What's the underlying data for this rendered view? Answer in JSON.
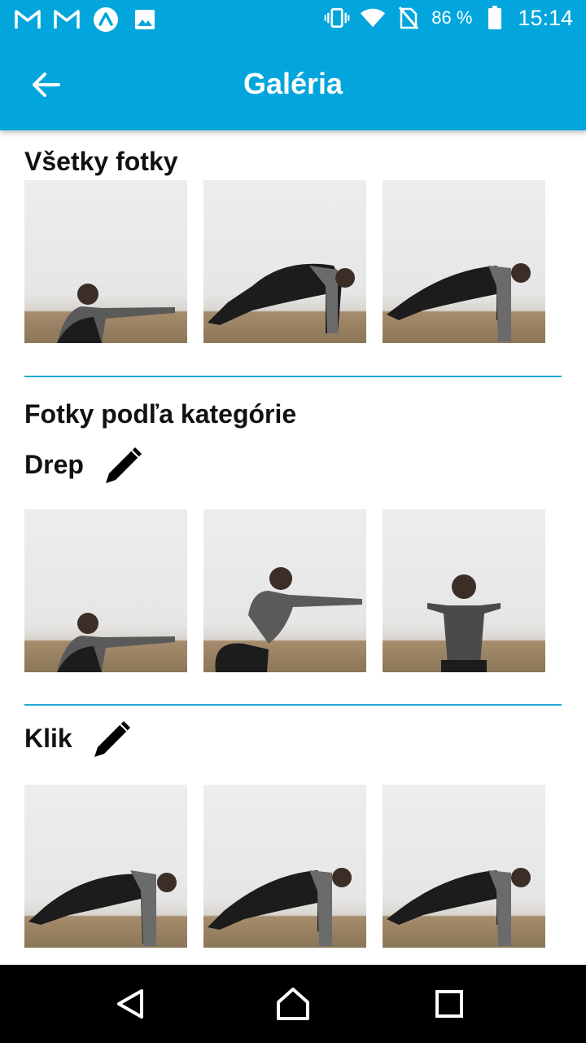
{
  "status_bar": {
    "icons_left": [
      "gmail-icon",
      "gmail-icon",
      "app-logo-icon",
      "image-icon"
    ],
    "battery_percent": "86 %",
    "time": "15:14"
  },
  "app_bar": {
    "title": "Galéria",
    "background": "#03a6dc"
  },
  "sections": {
    "all_photos": {
      "title": "Všetky fotky",
      "photos": [
        "person squat arms forward",
        "person plank push-up",
        "person push-up"
      ]
    },
    "by_category": {
      "title": "Fotky podľa kategórie"
    },
    "drep": {
      "title": "Drep",
      "photos": [
        "person squat low",
        "person squat mid",
        "person squat front view"
      ]
    },
    "klik": {
      "title": "Klik",
      "photos": [
        "person push-up",
        "person push-up",
        "person push-up"
      ]
    }
  },
  "colors": {
    "accent": "#03a6dc",
    "divider": "#22a6d4"
  },
  "nav": {
    "back": "nav-back-icon",
    "home": "nav-home-icon",
    "recents": "nav-recents-icon"
  }
}
